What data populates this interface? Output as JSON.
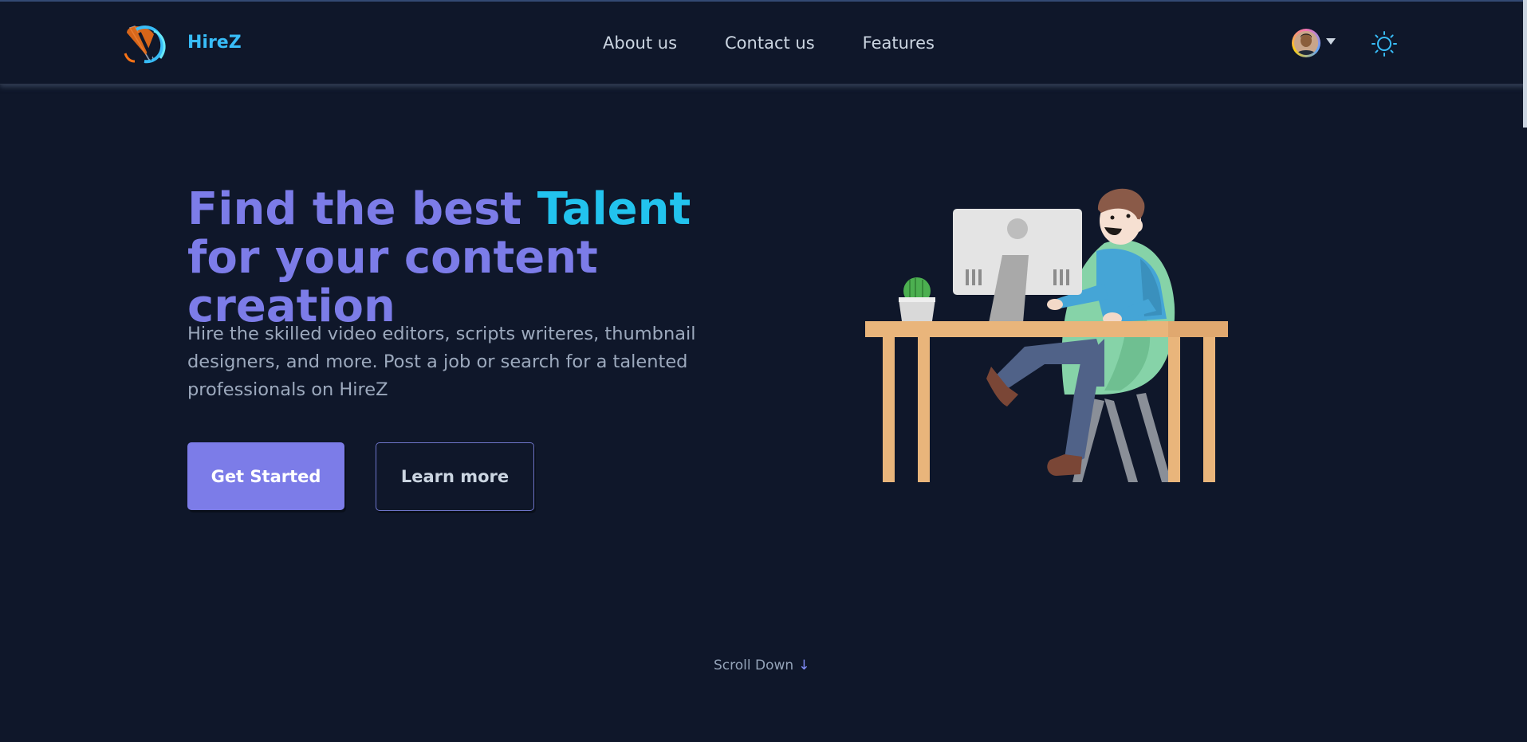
{
  "header": {
    "brand": "HireZ",
    "nav": [
      "About us",
      "Contact us",
      "Features"
    ]
  },
  "hero": {
    "title_part1": "Find the best ",
    "title_accent": "Talent",
    "title_part2": " for your content creation",
    "description": "Hire the skilled video editors, scripts writeres, thumbnail designers, and more. Post a job or search for a talented professionals on HireZ",
    "primary_button": "Get Started",
    "secondary_button": "Learn more"
  },
  "footer": {
    "scroll_down": "Scroll Down",
    "scroll_arrow": "↓"
  },
  "icons": {
    "logo": "hirez-logo-icon",
    "avatar": "user-avatar",
    "theme": "sun-icon",
    "caret": "chevron-down-icon"
  },
  "colors": {
    "background": "#0f172a",
    "brand": "#38bdf8",
    "primary": "#7c7ce8",
    "accent": "#22c3ee",
    "muted_text": "#9ca9bd"
  }
}
